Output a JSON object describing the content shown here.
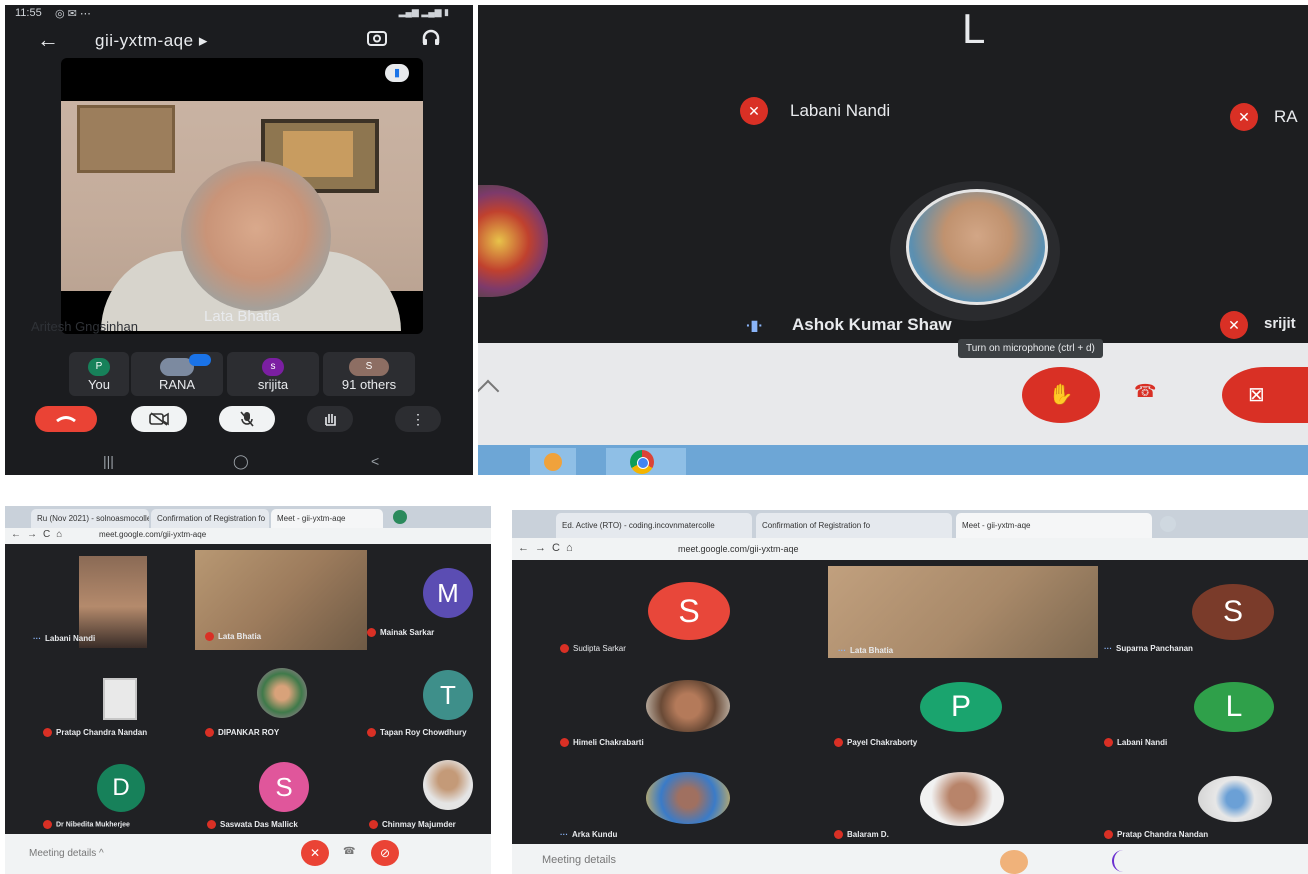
{
  "phone": {
    "status_time": "11:55",
    "meeting_code": "gii-yxtm-aqe",
    "meeting_code_suffix": "▸",
    "main_tile_name": "Lata Bhatia",
    "ghost_text": "Aritesh Gngsinhan",
    "chips": [
      {
        "label": "You",
        "avatar": "P"
      },
      {
        "label": "RANA",
        "avatar": ""
      },
      {
        "label": "srijita",
        "avatar": "s"
      },
      {
        "label": "91 others",
        "avatar": "S"
      }
    ],
    "nav_buttons": [
      "|||",
      "◯",
      "<"
    ]
  },
  "meet_top": {
    "letter_tile": "L",
    "participants": [
      "Labani Nandi",
      "RA",
      "Ashok Kumar Shaw",
      "srijit"
    ],
    "tooltip": "Turn on microphone (ctrl + d)"
  },
  "meet_left": {
    "tabs": [
      "Ru (Nov 2021) - solnoasmocolle",
      "Confirmation of Registration fo",
      "Meet - gii-yxtm-aqe"
    ],
    "url": "meet.google.com/gii-yxtm-aqe",
    "participants": [
      {
        "name": "Labani Nandi",
        "avatar": ""
      },
      {
        "name": "Lata Bhatia",
        "avatar": ""
      },
      {
        "name": "Mainak Sarkar",
        "avatar": "M",
        "color": "#5b4db3"
      },
      {
        "name": "Pratap Chandra Nandan",
        "avatar": ""
      },
      {
        "name": "DIPANKAR ROY",
        "avatar": ""
      },
      {
        "name": "Tapan Roy Chowdhury",
        "avatar": "T",
        "color": "#3e8f8a"
      },
      {
        "name": "Dr Nibedita Mukherjee",
        "avatar": "D",
        "color": "#17815a"
      },
      {
        "name": "Saswata Das Mallick",
        "avatar": "S",
        "color": "#e0569b"
      },
      {
        "name": "Chinmay Majumder",
        "avatar": ""
      }
    ],
    "meeting_details": "Meeting details ^"
  },
  "meet_right": {
    "tabs": [
      "Ed. Active (RTO) - coding.incovnmatercolle",
      "Confirmation of Registration fo",
      "Meet - gii-yxtm-aqe"
    ],
    "url": "meet.google.com/gii-yxtm-aqe",
    "participants": [
      {
        "name": "Sudipta Sarkar",
        "avatar": "S",
        "color": "#e8473a"
      },
      {
        "name": "Lata Bhatia",
        "avatar": ""
      },
      {
        "name": "Suparna Panchanan",
        "avatar": "S",
        "color": "#7a3b2a"
      },
      {
        "name": "Himeli Chakrabarti",
        "avatar": ""
      },
      {
        "name": "Payel Chakraborty",
        "avatar": "P",
        "color": "#1aa46e"
      },
      {
        "name": "Labani Nandi",
        "avatar": "L",
        "color": "#2fa04a"
      },
      {
        "name": "Arka Kundu",
        "avatar": ""
      },
      {
        "name": "Balaram D.",
        "avatar": ""
      },
      {
        "name": "Pratap Chandra Nandan",
        "avatar": ""
      }
    ],
    "meeting_details": "Meeting details"
  }
}
